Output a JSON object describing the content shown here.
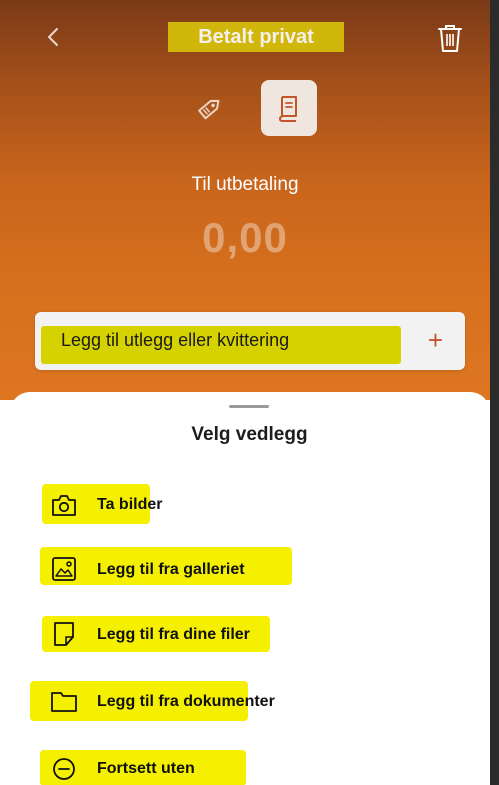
{
  "header": {
    "back_icon": "chevron-left-icon",
    "title": "Betalt privat",
    "trash_icon": "trash-icon"
  },
  "tabs": [
    {
      "icon": "tag-icon",
      "selected": false
    },
    {
      "icon": "receipt-icon",
      "selected": true
    }
  ],
  "payout": {
    "label": "Til utbetaling",
    "amount": "0,00"
  },
  "add_expense": {
    "label": "Legg til utlegg eller kvittering",
    "plus": "+"
  },
  "sheet": {
    "title": "Velg vedlegg",
    "options": [
      {
        "label": "Ta bilder",
        "icon": "camera-icon"
      },
      {
        "label": "Legg til fra galleriet",
        "icon": "image-gallery-icon"
      },
      {
        "label": "Legg til fra dine filer",
        "icon": "file-icon"
      },
      {
        "label": "Legg til fra dokumenter",
        "icon": "folder-icon"
      },
      {
        "label": "Fortsett uten",
        "icon": "minus-circle-icon"
      }
    ]
  },
  "colors": {
    "accent": "#c2552a",
    "highlight": "#f4f000",
    "header_gradient_top": "#7a3a17",
    "header_gradient_bottom": "#de7620"
  }
}
